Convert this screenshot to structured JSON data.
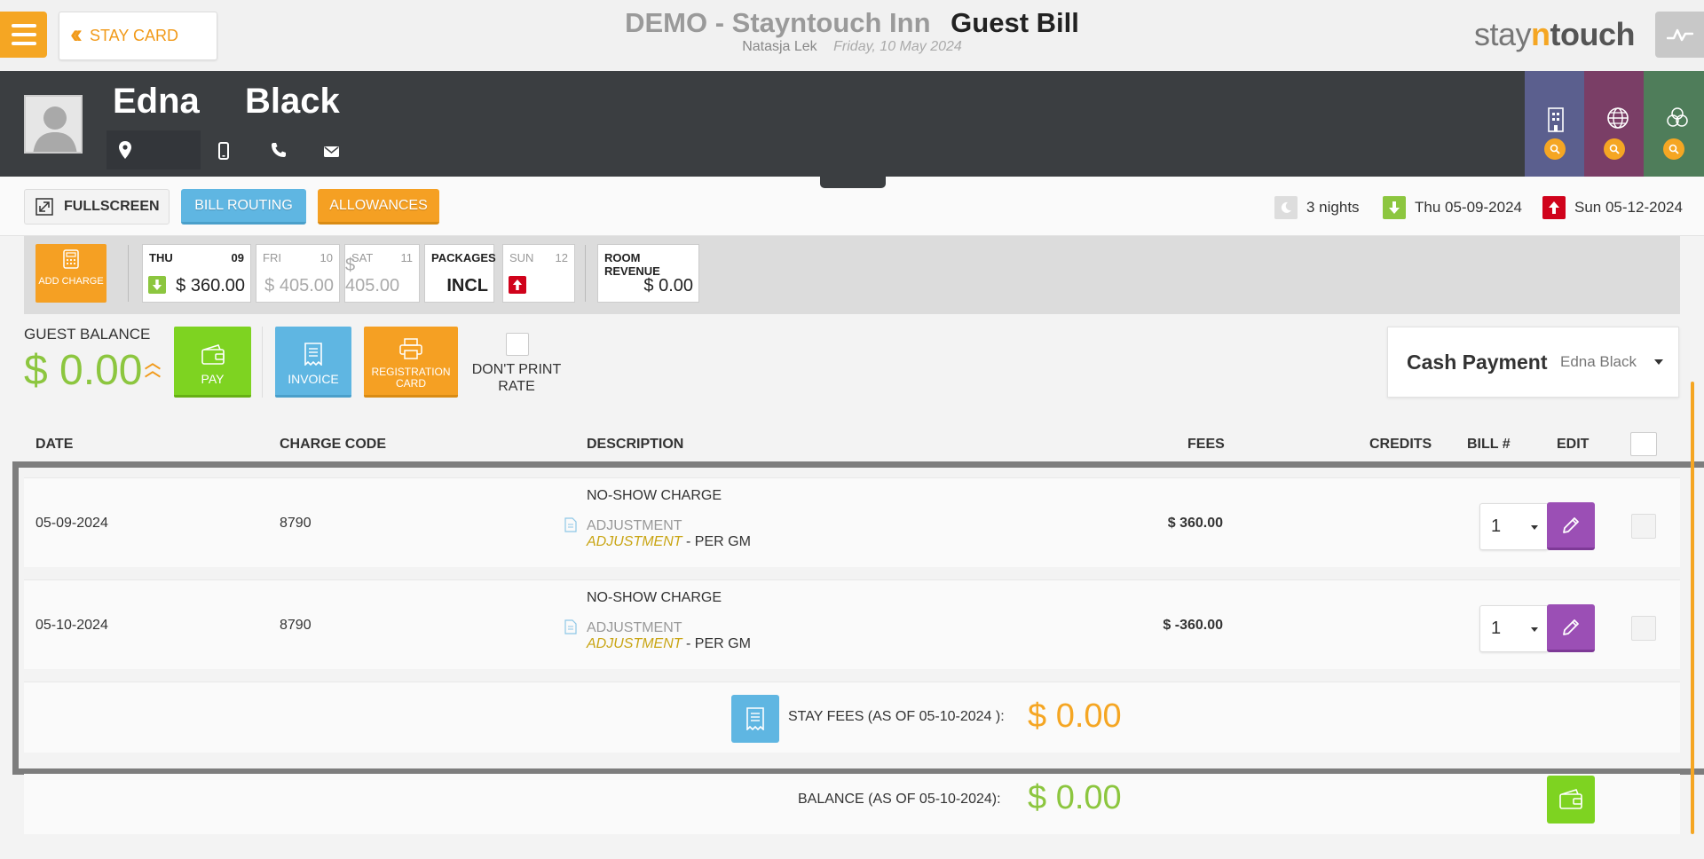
{
  "app": {
    "hotel_name": "DEMO - Stayntouch Inn",
    "page_title": "Guest Bill",
    "user_name": "Natasja Lek",
    "business_date": "Friday, 10 May 2024",
    "back_label": "STAY CARD",
    "logo": {
      "stay": "stay",
      "n": "n",
      "touch": "touch"
    },
    "brand_color": "#f5a623"
  },
  "guest": {
    "first_name": "Edna",
    "last_name": "Black",
    "tabs": [
      {
        "icon": "building-icon",
        "color": "#5b5f8e"
      },
      {
        "icon": "globe-icon",
        "color": "#7a3e66"
      },
      {
        "icon": "circles-icon",
        "color": "#4f7d5a"
      }
    ]
  },
  "toolbar": {
    "fullscreen_label": "FULLSCREEN",
    "bill_routing_label": "BILL ROUTING",
    "allowances_label": "ALLOWANCES",
    "nights": "3 nights",
    "arrival": "Thu 05-09-2024",
    "departure": "Sun 05-12-2024"
  },
  "calendar": {
    "add_charge_label": "ADD CHARGE",
    "days": [
      {
        "name": "THU",
        "num": "09",
        "value": "$ 360.00",
        "active": true,
        "mark": "arrival"
      },
      {
        "name": "FRI",
        "num": "10",
        "value": "$ 405.00",
        "active": false
      },
      {
        "name": "SAT",
        "num": "11",
        "value": "$ 405.00",
        "active": false
      },
      {
        "name": "PACKAGES",
        "num": "",
        "value": "INCL",
        "active": true
      },
      {
        "name": "SUN",
        "num": "12",
        "value": "",
        "active": false,
        "mark": "departure"
      }
    ],
    "room_revenue_label": "ROOM REVENUE",
    "room_revenue_value": "$ 0.00"
  },
  "balance": {
    "label": "GUEST BALANCE",
    "value": "$ 0.00",
    "pay_label": "PAY",
    "invoice_label": "INVOICE",
    "registration_label": "REGISTRATION CARD",
    "dont_print_rate_label": "DON'T PRINT RATE",
    "payment_type": "Cash Payment",
    "payment_guest": "Edna Black"
  },
  "table": {
    "headers": {
      "date": "DATE",
      "charge_code": "CHARGE CODE",
      "description": "DESCRIPTION",
      "fees": "FEES",
      "credits": "CREDITS",
      "bill_no": "BILL #",
      "edit": "EDIT"
    },
    "rows": [
      {
        "date": "05-09-2024",
        "charge_code": "8790",
        "description": "NO-SHOW CHARGE",
        "sub_type": "ADJUSTMENT",
        "sub_detail_italic": "ADJUSTMENT",
        "sub_detail_rest": " - PER GM",
        "fees": "$ 360.00",
        "credits": "",
        "bill_no": "1"
      },
      {
        "date": "05-10-2024",
        "charge_code": "8790",
        "description": "NO-SHOW CHARGE",
        "sub_type": "ADJUSTMENT",
        "sub_detail_italic": "ADJUSTMENT",
        "sub_detail_rest": " - PER GM",
        "fees": "$ -360.00",
        "credits": "",
        "bill_no": "1"
      }
    ],
    "stay_fees_label": "STAY FEES (AS OF  05-10-2024 ):",
    "stay_fees_value": "$ 0.00",
    "balance_label": "BALANCE (AS OF  05-10-2024):",
    "balance_value": "$ 0.00"
  }
}
